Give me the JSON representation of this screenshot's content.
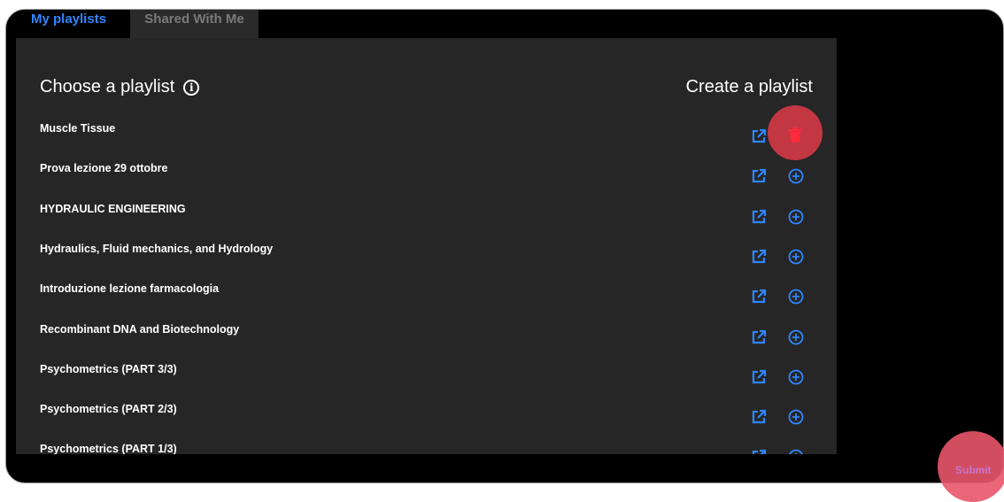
{
  "tabs": [
    {
      "label": "My playlists",
      "active": true
    },
    {
      "label": "Shared With Me",
      "active": false
    }
  ],
  "panel": {
    "title": "Choose a playlist",
    "create_label": "Create a playlist"
  },
  "playlists": [
    {
      "label": "Muscle Tissue"
    },
    {
      "label": "Prova lezione 29 ottobre"
    },
    {
      "label": "HYDRAULIC ENGINEERING"
    },
    {
      "label": "Hydraulics, Fluid mechanics, and Hydrology"
    },
    {
      "label": "Introduzione lezione farmacologia"
    },
    {
      "label": "Recombinant DNA and Biotechnology"
    },
    {
      "label": "Psychometrics (PART 3/3)"
    },
    {
      "label": "Psychometrics (PART 2/3)"
    },
    {
      "label": "Psychometrics (PART 1/3)"
    }
  ],
  "submit_label": "Submit",
  "colors": {
    "accent": "#2f86ff",
    "highlight": "#e63c4b",
    "panel": "#262626"
  },
  "icons": {
    "open": "external-link-icon",
    "add": "plus-circle-icon",
    "delete": "trash-icon",
    "info": "info-icon"
  }
}
